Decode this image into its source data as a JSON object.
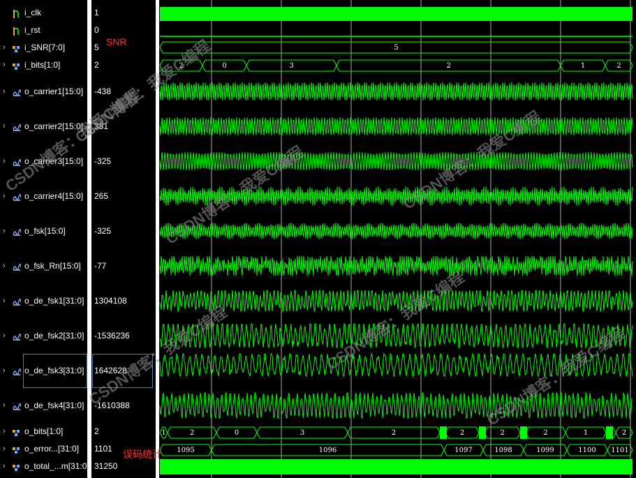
{
  "signals": [
    {
      "name": "i_clk",
      "value": "1",
      "kind": "bit",
      "expand": false
    },
    {
      "name": "i_rst",
      "value": "0",
      "kind": "bit",
      "expand": false
    },
    {
      "name": "i_SNR[7:0]",
      "value": "5",
      "kind": "bus",
      "expand": true
    },
    {
      "name": "i_bits[1:0]",
      "value": "2",
      "kind": "bus",
      "expand": true
    },
    {
      "name": "o_carrier1[15:0]",
      "value": "-438",
      "kind": "analog",
      "expand": true
    },
    {
      "name": "o_carrier2[15:0]",
      "value": "381",
      "kind": "analog",
      "expand": true
    },
    {
      "name": "o_carrier3[15:0]",
      "value": "-325",
      "kind": "analog",
      "expand": true
    },
    {
      "name": "o_carrier4[15:0]",
      "value": "265",
      "kind": "analog",
      "expand": true
    },
    {
      "name": "o_fsk[15:0]",
      "value": "-325",
      "kind": "analog",
      "expand": true
    },
    {
      "name": "o_fsk_Rn[15:0]",
      "value": "-77",
      "kind": "analog",
      "expand": true
    },
    {
      "name": "o_de_fsk1[31:0]",
      "value": "1304108",
      "kind": "analog",
      "expand": true
    },
    {
      "name": "o_de_fsk2[31:0]",
      "value": "-1536236",
      "kind": "analog",
      "expand": true
    },
    {
      "name": "o_de_fsk3[31:0]",
      "value": "1642628",
      "kind": "analog",
      "expand": true
    },
    {
      "name": "o_de_fsk4[31:0]",
      "value": "-1610388",
      "kind": "analog",
      "expand": true
    },
    {
      "name": "o_bits[1:0]",
      "value": "2",
      "kind": "bus",
      "expand": true
    },
    {
      "name": "o_error...[31:0]",
      "value": "1101",
      "kind": "bus",
      "expand": true
    },
    {
      "name": "o_total_...m[31:0]",
      "value": "31250",
      "kind": "bus",
      "expand": true
    }
  ],
  "annotations": {
    "snr": "SNR",
    "error_stats": "误码统计"
  },
  "watermarks": [
    "CSDN博客：我爱C编程",
    "CSDN博客：我爱C编程",
    "CSDN博客：我爱C编程",
    "CSDN博客：我爱C编程",
    "CSDN博客：我爱C编程",
    "CSDN博客：我爱C编程",
    "CSDN博客：我爱C编程"
  ],
  "bus_segments": {
    "i_SNR": [
      "5"
    ],
    "i_bits": [
      "2",
      "0",
      "3",
      "2",
      "1",
      "2"
    ],
    "o_bits": [
      "1",
      "2",
      "0",
      "3",
      "2",
      "2",
      "2",
      "2",
      "1",
      "2"
    ],
    "o_error": [
      "1095",
      "1096",
      "1097",
      "1098",
      "1099",
      "1100",
      "1101"
    ]
  },
  "colors": {
    "wave": "#00ff00",
    "grid": "#bfbfbf",
    "text": "#ffffff",
    "annotation": "#ff3030",
    "selection": "#5a7ab0"
  }
}
